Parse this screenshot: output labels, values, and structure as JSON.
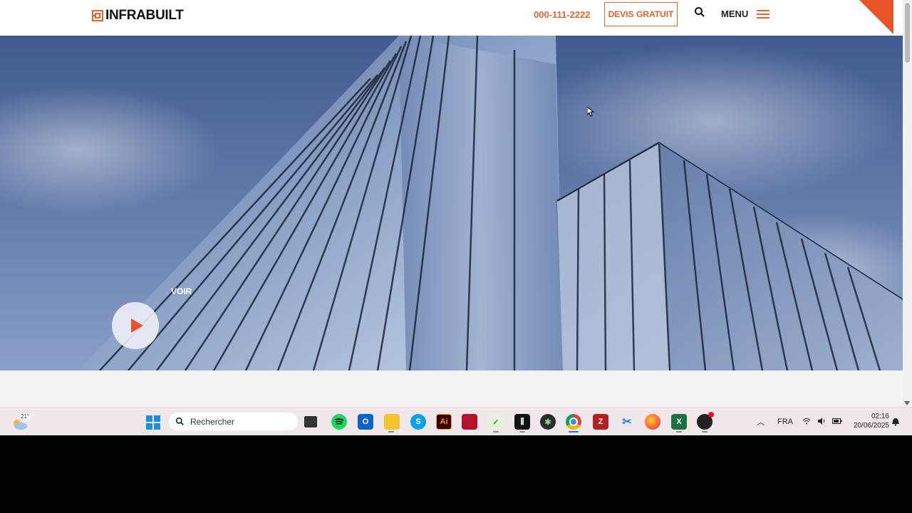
{
  "header": {
    "logo_text": "INFRABUILT",
    "phone": "000-111-2222",
    "cta_label": "DEVIS GRATUIT",
    "menu_label": "MENU",
    "accent_color": "#e8622a"
  },
  "hero": {
    "play_label": "VOIR",
    "play_icon": "play-icon"
  },
  "taskbar": {
    "weather_temp": "21°",
    "search_placeholder": "Rechercher",
    "apps": [
      "task-view",
      "spotify",
      "outlook",
      "file-explorer",
      "skype",
      "illustrator",
      "app-red",
      "app-green-check",
      "app-piano",
      "app-green-sphere",
      "chrome",
      "filezilla",
      "snipping-tool",
      "firefox",
      "excel",
      "app-black-red-dot"
    ],
    "language": "FRA",
    "time": "02:16",
    "date": "20/06/2025"
  }
}
